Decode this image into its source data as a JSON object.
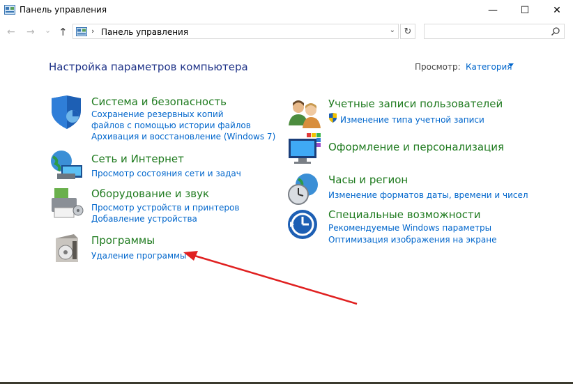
{
  "window": {
    "title": "Панель управления",
    "minimize": "—",
    "maximize": "☐",
    "close": "✕"
  },
  "nav": {
    "back": "←",
    "forward": "→",
    "recent": "⌄",
    "up": "↑",
    "address_separator": "›",
    "address": "Панель управления",
    "address_dropdown": "⌄",
    "refresh": "↻",
    "search_placeholder": ""
  },
  "header": {
    "title": "Настройка параметров компьютера",
    "view_label": "Просмотр:",
    "view_value": "Категория"
  },
  "categories_left": [
    {
      "title": "Система и безопасность",
      "links": [
        "Сохранение резервных копий файлов с помощью истории файлов",
        "Архивация и восстановление (Windows 7)"
      ],
      "icon": "shield-icon"
    },
    {
      "title": "Сеть и Интернет",
      "links": [
        "Просмотр состояния сети и задач"
      ],
      "icon": "network-globe-icon"
    },
    {
      "title": "Оборудование и звук",
      "links": [
        "Просмотр устройств и принтеров",
        "Добавление устройства"
      ],
      "icon": "printer-icon"
    },
    {
      "title": "Программы",
      "links": [
        "Удаление программы"
      ],
      "icon": "programs-box-icon"
    }
  ],
  "categories_right": [
    {
      "title": "Учетные записи пользователей",
      "links": [
        "Изменение типа учетной записи"
      ],
      "icon": "users-icon"
    },
    {
      "title": "Оформление и персонализация",
      "links": [],
      "icon": "monitor-palette-icon"
    },
    {
      "title": "Часы и регион",
      "links": [
        "Изменение форматов даты, времени и чисел"
      ],
      "icon": "clock-globe-icon"
    },
    {
      "title": "Специальные возможности",
      "links": [
        "Рекомендуемые Windows параметры",
        "Оптимизация изображения на экране"
      ],
      "icon": "ease-of-access-icon"
    }
  ],
  "colors": {
    "title_blue": "#1e3287",
    "category_green": "#1e7a1e",
    "link_blue": "#0066cc",
    "arrow_red": "#e02020"
  }
}
